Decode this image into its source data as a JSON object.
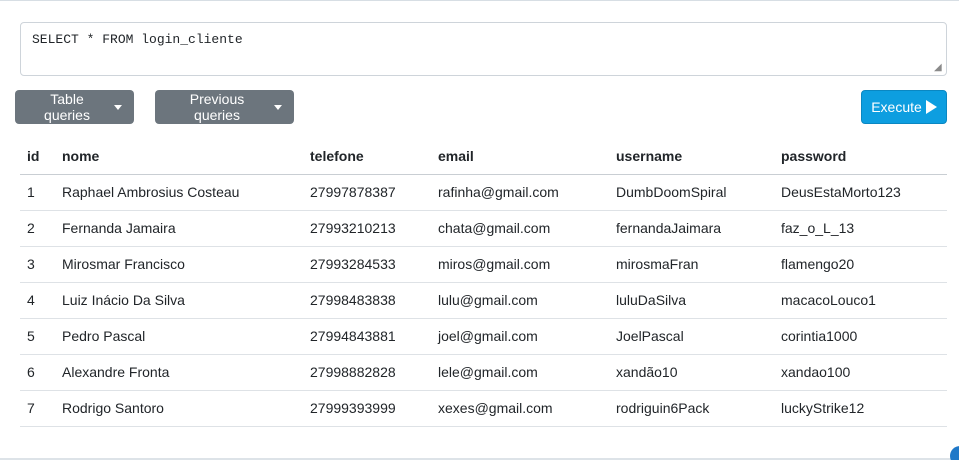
{
  "query": {
    "text": "SELECT * FROM login_cliente"
  },
  "toolbar": {
    "table_queries_label": "Table queries",
    "previous_queries_label": "Previous queries",
    "execute_label": "Execute"
  },
  "colors": {
    "secondary": "#6c757d",
    "primary": "#0d9ee0"
  },
  "icons": {
    "dropdown": "caret-down-icon",
    "execute": "play-icon"
  },
  "table": {
    "columns": [
      "id",
      "nome",
      "telefone",
      "email",
      "username",
      "password"
    ],
    "rows": [
      [
        "1",
        "Raphael Ambrosius Costeau",
        "27997878387",
        "rafinha@gmail.com",
        "DumbDoomSpiral",
        "DeusEstaMorto123"
      ],
      [
        "2",
        "Fernanda Jamaira",
        "27993210213",
        "chata@gmail.com",
        "fernandaJaimara",
        "faz_o_L_13"
      ],
      [
        "3",
        "Mirosmar Francisco",
        "27993284533",
        "miros@gmail.com",
        "mirosmaFran",
        "flamengo20"
      ],
      [
        "4",
        "Luiz Inácio Da Silva",
        "27998483838",
        "lulu@gmail.com",
        "luluDaSilva",
        "macacoLouco1"
      ],
      [
        "5",
        "Pedro Pascal",
        "27994843881",
        "joel@gmail.com",
        "JoelPascal",
        "corintia1000"
      ],
      [
        "6",
        "Alexandre Fronta",
        "27998882828",
        "lele@gmail.com",
        "xandão10",
        "xandao100"
      ],
      [
        "7",
        "Rodrigo Santoro",
        "27999393999",
        "xexes@gmail.com",
        "rodriguin6Pack",
        "luckyStrike12"
      ]
    ]
  }
}
